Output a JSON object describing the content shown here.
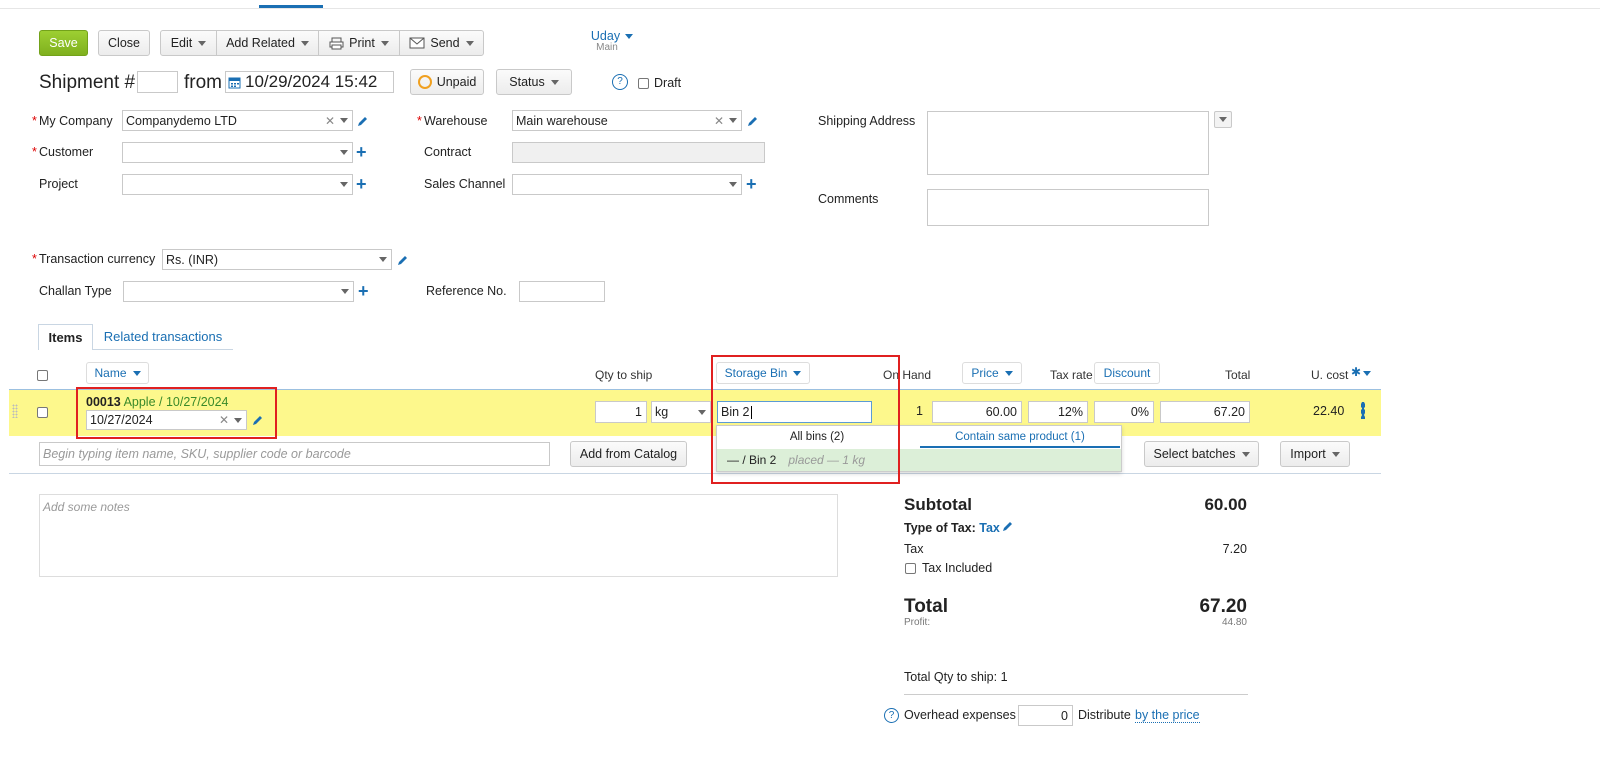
{
  "toolbar": {
    "save": "Save",
    "close": "Close",
    "edit": "Edit",
    "add_related": "Add Related",
    "print": "Print",
    "send": "Send"
  },
  "user": {
    "name": "Uday",
    "sub": "Main"
  },
  "title_row": {
    "shipment_label": "Shipment #",
    "number": "",
    "from": "from",
    "datetime": "10/29/2024 15:42",
    "unpaid": "Unpaid",
    "status": "Status",
    "help": "?",
    "draft": "Draft"
  },
  "form": {
    "my_company_label": "My Company",
    "my_company_value": "Companydemo LTD",
    "customer_label": "Customer",
    "customer_value": "",
    "project_label": "Project",
    "project_value": "",
    "warehouse_label": "Warehouse",
    "warehouse_value": "Main warehouse",
    "contract_label": "Contract",
    "sales_channel_label": "Sales Channel",
    "shipping_address_label": "Shipping Address",
    "comments_label": "Comments",
    "currency_label": "Transaction currency",
    "currency_value": "Rs. (INR)",
    "challan_label": "Challan Type",
    "challan_value": "",
    "reference_label": "Reference No.",
    "reference_value": ""
  },
  "tabs": {
    "items": "Items",
    "related": "Related transactions"
  },
  "columns": {
    "name": "Name",
    "qty": "Qty to ship",
    "storage_bin": "Storage Bin",
    "on_hand": "On Hand",
    "price": "Price",
    "tax_rate": "Tax rate",
    "discount": "Discount",
    "total": "Total",
    "u_cost": "U. cost"
  },
  "row": {
    "code": "00013",
    "product": "Apple / 10/27/2024",
    "batch": "10/27/2024",
    "qty": "1",
    "unit": "kg",
    "bin_input": "Bin 2",
    "on_hand": "1",
    "price": "60.00",
    "tax_rate": "12%",
    "discount": "0%",
    "total": "67.20",
    "u_cost": "22.40"
  },
  "bin_dropdown": {
    "tab_all": "All bins (2)",
    "tab_same": "Contain same product (1)",
    "item_name": "— / Bin 2",
    "item_note": "placed — 1 kg"
  },
  "add_row": {
    "placeholder": "Begin typing item name, SKU, supplier code or barcode",
    "add_from_catalog": "Add from Catalog",
    "select_batches": "Select batches",
    "import": "Import"
  },
  "notes_placeholder": "Add some notes",
  "summary": {
    "subtotal_label": "Subtotal",
    "subtotal": "60.00",
    "tax_type_label": "Type of Tax:",
    "tax_type": "Tax",
    "tax_label": "Tax",
    "tax": "7.20",
    "tax_included": "Tax Included",
    "total_label": "Total",
    "total": "67.20",
    "profit_label": "Profit:",
    "profit": "44.80",
    "total_qty": "Total Qty to ship: 1",
    "overhead_label": "Overhead expenses",
    "overhead": "0",
    "distribute": "Distribute",
    "distribute_link": "by the price"
  },
  "colors": {
    "save_green": "#8ab923",
    "highlight_row": "#fdf88c",
    "link": "#1a6fb3",
    "annot_red": "#e02020"
  }
}
